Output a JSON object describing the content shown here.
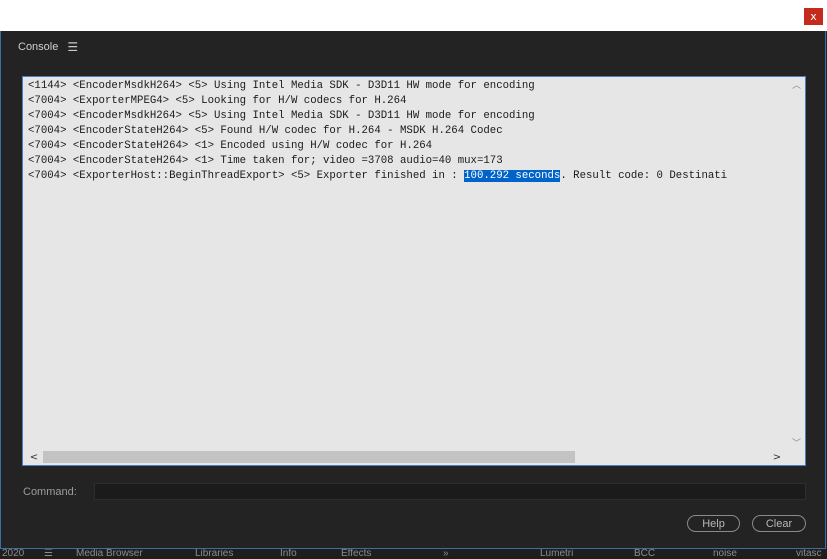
{
  "window": {
    "close_glyph": "x"
  },
  "panel": {
    "title": "Console",
    "menu_icon": "hamburger-menu-icon"
  },
  "console": {
    "lines": [
      "<1144> <EncoderMsdkH264> <5> Using Intel Media SDK - D3D11 HW mode for encoding",
      "<7004> <ExporterMPEG4> <5> Looking for H/W codecs for H.264",
      "<7004> <EncoderMsdkH264> <5> Using Intel Media SDK - D3D11 HW mode for encoding",
      "<7004> <EncoderStateH264> <5> Found H/W codec for H.264 - MSDK H.264 Codec",
      "<7004> <EncoderStateH264> <1> Encoded using H/W codec for H.264",
      "<7004> <EncoderStateH264> <1> Time taken for; video =3708 audio=40 mux=173"
    ],
    "last_line": {
      "before": "<7004> <ExporterHost::BeginThreadExport> <5> Exporter finished in : ",
      "highlighted": "100.292 seconds",
      "after": ". Result code: 0 Destinati"
    },
    "highlight_color": "#0063c9"
  },
  "command": {
    "label": "Command:",
    "value": ""
  },
  "buttons": {
    "help": "Help",
    "clear": "Clear"
  },
  "background_tabs": {
    "year": "2020",
    "items": [
      "Media Browser",
      "Libraries",
      "Info",
      "Effects",
      "»",
      "Lumetri",
      "BCC",
      "noise",
      "vitasc"
    ]
  }
}
